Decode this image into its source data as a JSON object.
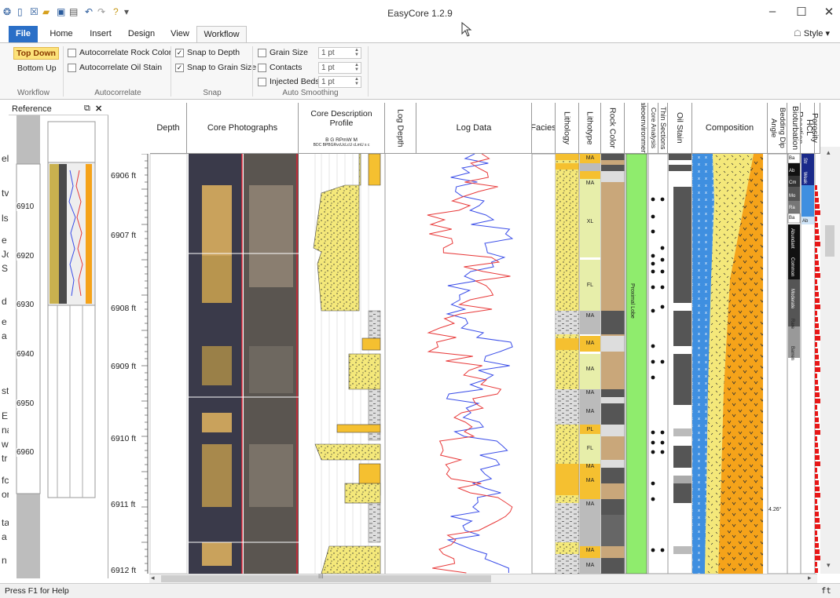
{
  "app_title": "EasyCore 1.2.9",
  "window_controls": {
    "minimize": "–",
    "maximize": "☐",
    "close": "✕"
  },
  "tabs": [
    "File",
    "Home",
    "Insert",
    "Design",
    "View",
    "Workflow"
  ],
  "style_menu": "Style",
  "ribbon": {
    "workflow": {
      "top_down": "Top Down",
      "bottom_up": "Bottom Up",
      "label": "Workflow"
    },
    "autocorrelate": {
      "rock_color": "Autocorrelate Rock Color",
      "oil_stain": "Autocorrelate Oil Stain",
      "label": "Autocorrelate"
    },
    "snap": {
      "depth": "Snap to Depth",
      "grain_size": "Snap to Grain Size",
      "label": "Snap"
    },
    "auto_smoothing": {
      "grain_size": "Grain Size",
      "contacts": "Contacts",
      "injected_beds": "Injected Beds",
      "value": "1 pt",
      "label": "Auto Smoothing"
    }
  },
  "reference": {
    "title": "Reference",
    "depths": [
      "6910",
      "6920",
      "6930",
      "6940",
      "6950",
      "6960"
    ]
  },
  "edge_letters": [
    "el",
    "tv",
    "ls",
    "e",
    "Jc",
    "S",
    "d",
    "e",
    "a",
    "st",
    "E",
    "na",
    "w",
    "tr",
    "fc",
    "or",
    "ta",
    "a",
    "n"
  ],
  "depth_labels": [
    "6906 ft",
    "6907 ft",
    "6908 ft",
    "6909 ft",
    "6910 ft",
    "6911 ft",
    "6912 ft"
  ],
  "headers": {
    "depth": "Depth",
    "core_photographs": "Core Photographs",
    "core_description": "Core Description Profile",
    "grain_codes": "B G RPmW M",
    "grain_codes_2": "BDC BPBGRvcUcLcU cLmU s  c",
    "log_depth": "Log Depth",
    "log_data": "Log Data",
    "facies": "Facies",
    "lithology": "Lithology",
    "lithotype": "Lithotype",
    "rock_color": "Rock Color",
    "paleoenvironment": "aleoenvironmen",
    "core_analysis": "Core Analysis",
    "thin_sections": "Thin Sections",
    "oil_stain": "Oil Stain",
    "composition": "Composition",
    "bedding_dip": "Bedding Dip Angle",
    "bioturbation": "Bioturbation",
    "hcl_reaction": "HCL Reaction",
    "porosity": "Porosity"
  },
  "lithotype_labels": [
    "MA",
    "MA",
    "XL",
    "FL",
    "MA",
    "MA",
    "MA",
    "MA",
    "MA",
    "PL",
    "FL",
    "MA",
    "MA",
    "MA",
    "MA",
    "MA"
  ],
  "paleo_label": "Proximal Lobe",
  "dip_value": "4.26°",
  "bio_labels": [
    "Ba",
    "Ab",
    "Cm",
    "Mo",
    "Ra",
    "Ba",
    "Abundant",
    "Common",
    "Moderate",
    "Rare",
    "Barren"
  ],
  "hcl_labels": [
    "Str",
    "Weak",
    "Ab"
  ],
  "status_text": "Press F1 for Help",
  "status_right": "ft",
  "colors": {
    "file_tab": "#2a6fc7",
    "sand": "#f4e87a",
    "orange": "#f5a31a",
    "paleo": "#8fec6d",
    "blue_comp": "#3f8fe0",
    "porosity": "#e81818"
  }
}
